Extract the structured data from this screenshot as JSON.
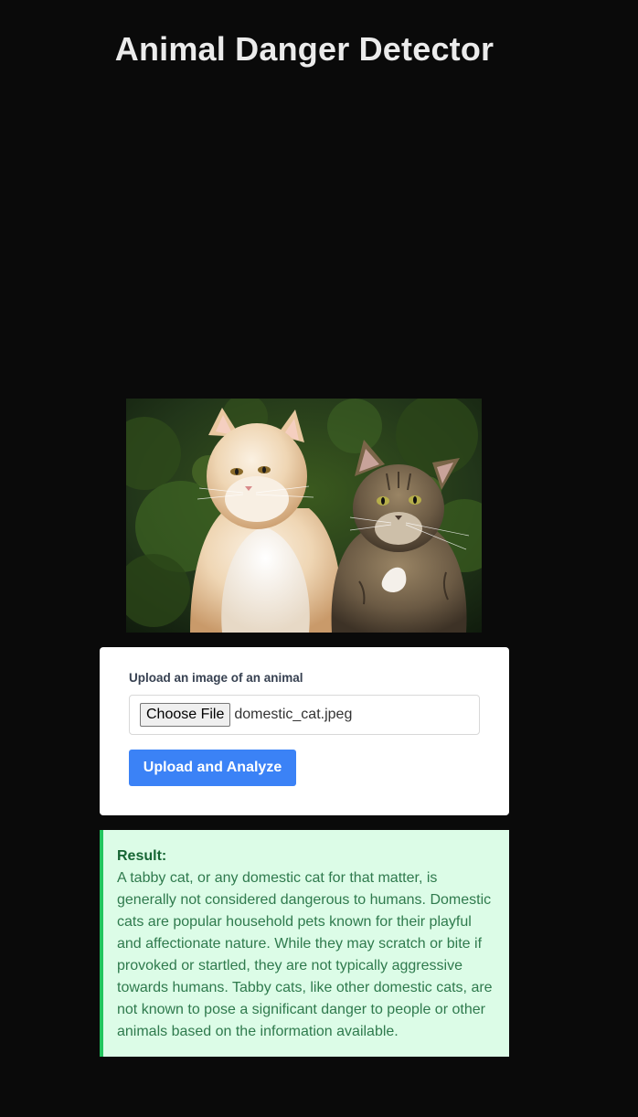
{
  "header": {
    "title": "Animal Danger Detector"
  },
  "preview": {
    "alt": "domestic_cat.jpeg preview",
    "subjects": [
      "cream-longhair-cat",
      "brown-tabby-cat"
    ]
  },
  "upload_form": {
    "label": "Upload an image of an animal",
    "choose_button_label": "Choose File",
    "selected_file": "domestic_cat.jpeg",
    "submit_label": "Upload and Analyze"
  },
  "result": {
    "heading": "Result:",
    "text": "A tabby cat, or any domestic cat for that matter, is generally not considered dangerous to humans. Domestic cats are popular household pets known for their playful and affectionate nature. While they may scratch or bite if provoked or startled, they are not typically aggressive towards humans. Tabby cats, like other domestic cats, are not known to pose a significant danger to people or other animals based on the information available."
  },
  "colors": {
    "background": "#0a0a0a",
    "title": "#ebebeb",
    "primary_button": "#3b82f6",
    "result_background": "#dcfce7",
    "result_border": "#22c55e",
    "result_text": "#2f7a4d"
  }
}
